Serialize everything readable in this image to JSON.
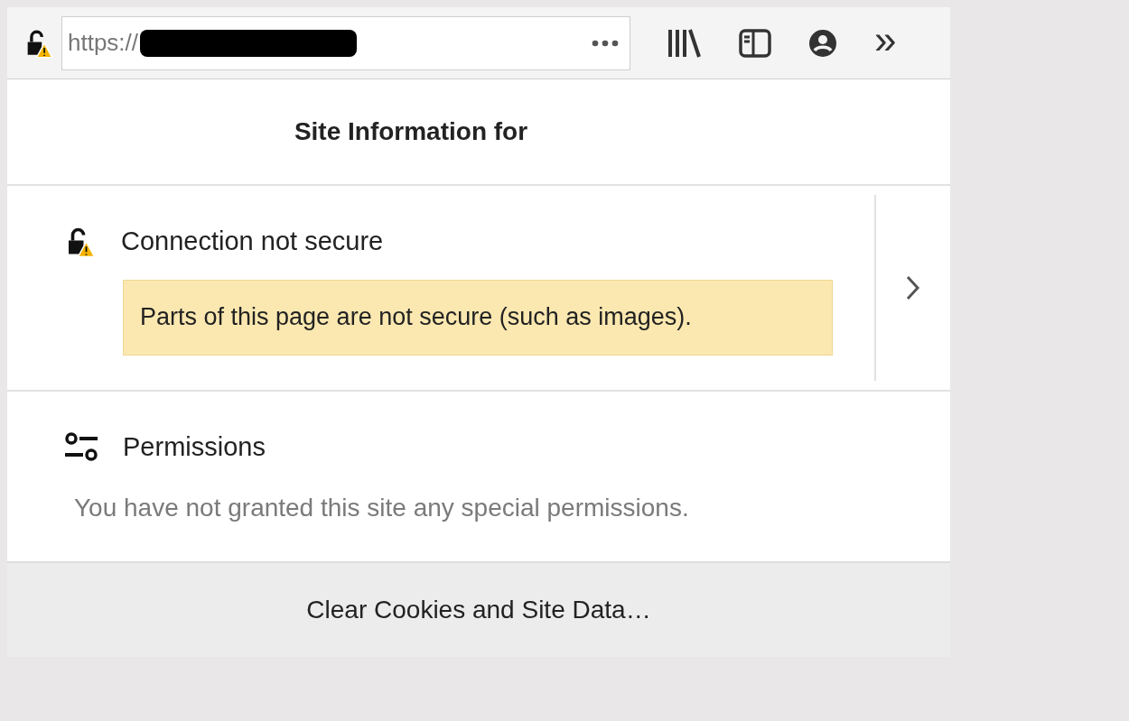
{
  "address_bar": {
    "url": "https://",
    "redacted": true
  },
  "toolbar": {
    "overflow_indicator": "»"
  },
  "site_panel": {
    "title": "Site Information for",
    "connection": {
      "label": "Connection not secure",
      "warning": "Parts of this page are not secure (such as images)."
    },
    "permissions": {
      "label": "Permissions",
      "message": "You have not granted this site any special permissions."
    },
    "footer_button": "Clear Cookies and Site Data…"
  }
}
